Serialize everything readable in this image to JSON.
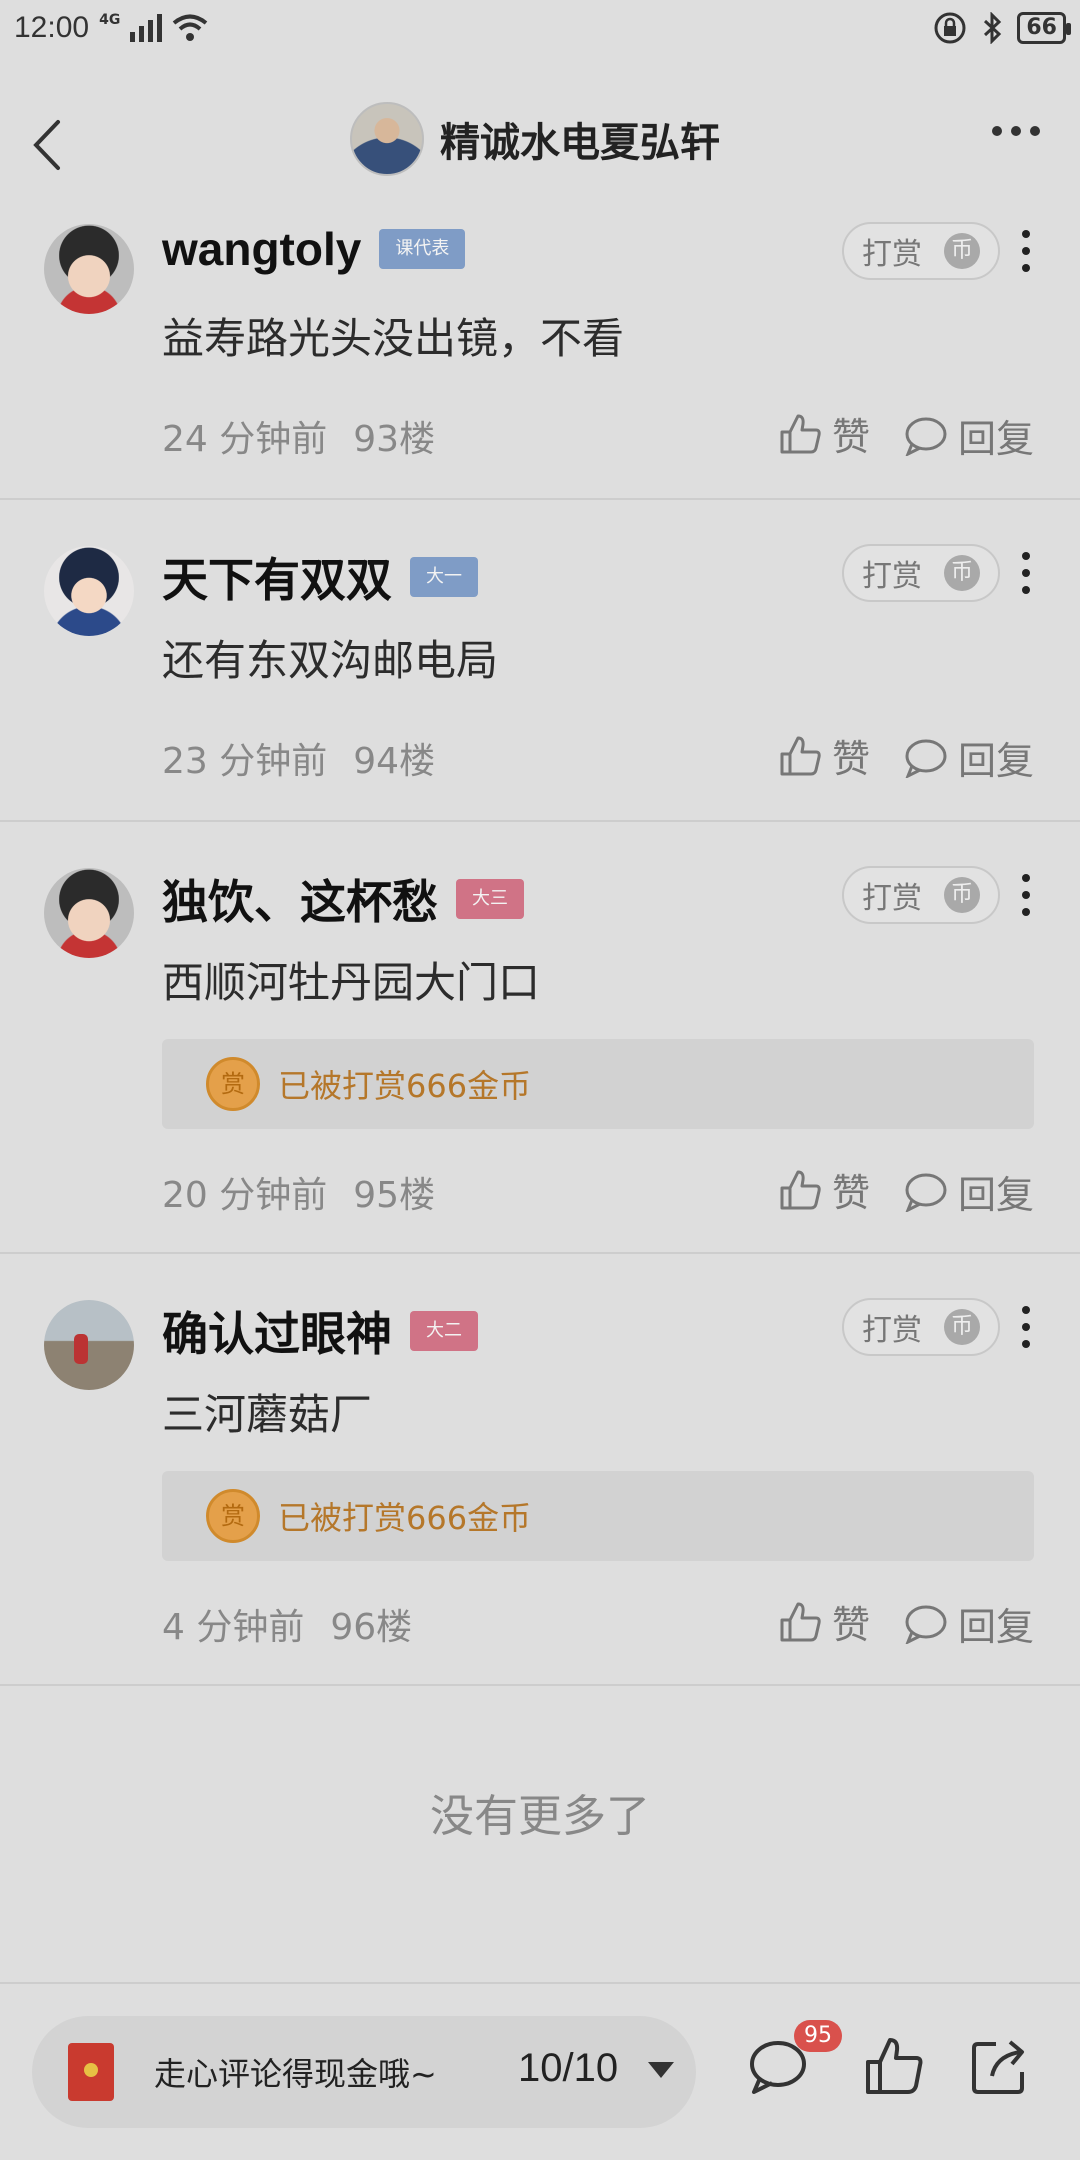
{
  "status": {
    "time": "12:00",
    "network": "4G",
    "battery": "66"
  },
  "header": {
    "title": "精诚水电夏弘轩"
  },
  "comments": [
    {
      "user": "wangtoly",
      "badge": "课代表",
      "badge_color": "#7f9cc6",
      "text": "益寿路光头没出镜，不看",
      "time": "24 分钟前",
      "floor": "93楼",
      "reward": null
    },
    {
      "user": "天下有双双",
      "badge": "大一",
      "badge_color": "#7f9cc6",
      "text": "还有东双沟邮电局",
      "time": "23 分钟前",
      "floor": "94楼",
      "reward": null
    },
    {
      "user": "独饮、这杯愁",
      "badge": "大三",
      "badge_color": "#d07386",
      "text": "西顺河牡丹园大门口",
      "time": "20 分钟前",
      "floor": "95楼",
      "reward": "已被打赏666金币"
    },
    {
      "user": "确认过眼神",
      "badge": "大二",
      "badge_color": "#d07386",
      "text": "三河蘑菇厂",
      "time": "4 分钟前",
      "floor": "96楼",
      "reward": "已被打赏666金币"
    }
  ],
  "labels": {
    "tip": "打赏",
    "tip_coin": "币",
    "like": "赞",
    "reply": "回复",
    "reward_coin": "赏"
  },
  "no_more": "没有更多了",
  "bottom": {
    "placeholder": "走心评论得现金哦~",
    "count": "10/10",
    "comment_badge": "95"
  }
}
